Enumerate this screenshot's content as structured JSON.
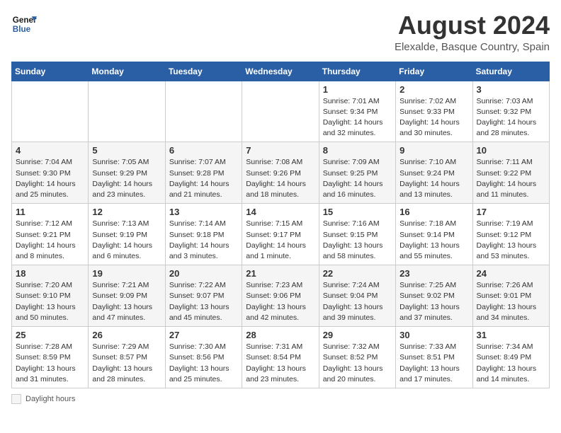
{
  "header": {
    "logo_line1": "General",
    "logo_line2": "Blue",
    "title": "August 2024",
    "subtitle": "Elexalde, Basque Country, Spain"
  },
  "weekdays": [
    "Sunday",
    "Monday",
    "Tuesday",
    "Wednesday",
    "Thursday",
    "Friday",
    "Saturday"
  ],
  "weeks": [
    [
      {
        "day": "",
        "sunrise": "",
        "sunset": "",
        "daylight": ""
      },
      {
        "day": "",
        "sunrise": "",
        "sunset": "",
        "daylight": ""
      },
      {
        "day": "",
        "sunrise": "",
        "sunset": "",
        "daylight": ""
      },
      {
        "day": "",
        "sunrise": "",
        "sunset": "",
        "daylight": ""
      },
      {
        "day": "1",
        "sunrise": "Sunrise: 7:01 AM",
        "sunset": "Sunset: 9:34 PM",
        "daylight": "Daylight: 14 hours and 32 minutes."
      },
      {
        "day": "2",
        "sunrise": "Sunrise: 7:02 AM",
        "sunset": "Sunset: 9:33 PM",
        "daylight": "Daylight: 14 hours and 30 minutes."
      },
      {
        "day": "3",
        "sunrise": "Sunrise: 7:03 AM",
        "sunset": "Sunset: 9:32 PM",
        "daylight": "Daylight: 14 hours and 28 minutes."
      }
    ],
    [
      {
        "day": "4",
        "sunrise": "Sunrise: 7:04 AM",
        "sunset": "Sunset: 9:30 PM",
        "daylight": "Daylight: 14 hours and 25 minutes."
      },
      {
        "day": "5",
        "sunrise": "Sunrise: 7:05 AM",
        "sunset": "Sunset: 9:29 PM",
        "daylight": "Daylight: 14 hours and 23 minutes."
      },
      {
        "day": "6",
        "sunrise": "Sunrise: 7:07 AM",
        "sunset": "Sunset: 9:28 PM",
        "daylight": "Daylight: 14 hours and 21 minutes."
      },
      {
        "day": "7",
        "sunrise": "Sunrise: 7:08 AM",
        "sunset": "Sunset: 9:26 PM",
        "daylight": "Daylight: 14 hours and 18 minutes."
      },
      {
        "day": "8",
        "sunrise": "Sunrise: 7:09 AM",
        "sunset": "Sunset: 9:25 PM",
        "daylight": "Daylight: 14 hours and 16 minutes."
      },
      {
        "day": "9",
        "sunrise": "Sunrise: 7:10 AM",
        "sunset": "Sunset: 9:24 PM",
        "daylight": "Daylight: 14 hours and 13 minutes."
      },
      {
        "day": "10",
        "sunrise": "Sunrise: 7:11 AM",
        "sunset": "Sunset: 9:22 PM",
        "daylight": "Daylight: 14 hours and 11 minutes."
      }
    ],
    [
      {
        "day": "11",
        "sunrise": "Sunrise: 7:12 AM",
        "sunset": "Sunset: 9:21 PM",
        "daylight": "Daylight: 14 hours and 8 minutes."
      },
      {
        "day": "12",
        "sunrise": "Sunrise: 7:13 AM",
        "sunset": "Sunset: 9:19 PM",
        "daylight": "Daylight: 14 hours and 6 minutes."
      },
      {
        "day": "13",
        "sunrise": "Sunrise: 7:14 AM",
        "sunset": "Sunset: 9:18 PM",
        "daylight": "Daylight: 14 hours and 3 minutes."
      },
      {
        "day": "14",
        "sunrise": "Sunrise: 7:15 AM",
        "sunset": "Sunset: 9:17 PM",
        "daylight": "Daylight: 14 hours and 1 minute."
      },
      {
        "day": "15",
        "sunrise": "Sunrise: 7:16 AM",
        "sunset": "Sunset: 9:15 PM",
        "daylight": "Daylight: 13 hours and 58 minutes."
      },
      {
        "day": "16",
        "sunrise": "Sunrise: 7:18 AM",
        "sunset": "Sunset: 9:14 PM",
        "daylight": "Daylight: 13 hours and 55 minutes."
      },
      {
        "day": "17",
        "sunrise": "Sunrise: 7:19 AM",
        "sunset": "Sunset: 9:12 PM",
        "daylight": "Daylight: 13 hours and 53 minutes."
      }
    ],
    [
      {
        "day": "18",
        "sunrise": "Sunrise: 7:20 AM",
        "sunset": "Sunset: 9:10 PM",
        "daylight": "Daylight: 13 hours and 50 minutes."
      },
      {
        "day": "19",
        "sunrise": "Sunrise: 7:21 AM",
        "sunset": "Sunset: 9:09 PM",
        "daylight": "Daylight: 13 hours and 47 minutes."
      },
      {
        "day": "20",
        "sunrise": "Sunrise: 7:22 AM",
        "sunset": "Sunset: 9:07 PM",
        "daylight": "Daylight: 13 hours and 45 minutes."
      },
      {
        "day": "21",
        "sunrise": "Sunrise: 7:23 AM",
        "sunset": "Sunset: 9:06 PM",
        "daylight": "Daylight: 13 hours and 42 minutes."
      },
      {
        "day": "22",
        "sunrise": "Sunrise: 7:24 AM",
        "sunset": "Sunset: 9:04 PM",
        "daylight": "Daylight: 13 hours and 39 minutes."
      },
      {
        "day": "23",
        "sunrise": "Sunrise: 7:25 AM",
        "sunset": "Sunset: 9:02 PM",
        "daylight": "Daylight: 13 hours and 37 minutes."
      },
      {
        "day": "24",
        "sunrise": "Sunrise: 7:26 AM",
        "sunset": "Sunset: 9:01 PM",
        "daylight": "Daylight: 13 hours and 34 minutes."
      }
    ],
    [
      {
        "day": "25",
        "sunrise": "Sunrise: 7:28 AM",
        "sunset": "Sunset: 8:59 PM",
        "daylight": "Daylight: 13 hours and 31 minutes."
      },
      {
        "day": "26",
        "sunrise": "Sunrise: 7:29 AM",
        "sunset": "Sunset: 8:57 PM",
        "daylight": "Daylight: 13 hours and 28 minutes."
      },
      {
        "day": "27",
        "sunrise": "Sunrise: 7:30 AM",
        "sunset": "Sunset: 8:56 PM",
        "daylight": "Daylight: 13 hours and 25 minutes."
      },
      {
        "day": "28",
        "sunrise": "Sunrise: 7:31 AM",
        "sunset": "Sunset: 8:54 PM",
        "daylight": "Daylight: 13 hours and 23 minutes."
      },
      {
        "day": "29",
        "sunrise": "Sunrise: 7:32 AM",
        "sunset": "Sunset: 8:52 PM",
        "daylight": "Daylight: 13 hours and 20 minutes."
      },
      {
        "day": "30",
        "sunrise": "Sunrise: 7:33 AM",
        "sunset": "Sunset: 8:51 PM",
        "daylight": "Daylight: 13 hours and 17 minutes."
      },
      {
        "day": "31",
        "sunrise": "Sunrise: 7:34 AM",
        "sunset": "Sunset: 8:49 PM",
        "daylight": "Daylight: 13 hours and 14 minutes."
      }
    ]
  ],
  "footer": {
    "daylight_label": "Daylight hours"
  }
}
